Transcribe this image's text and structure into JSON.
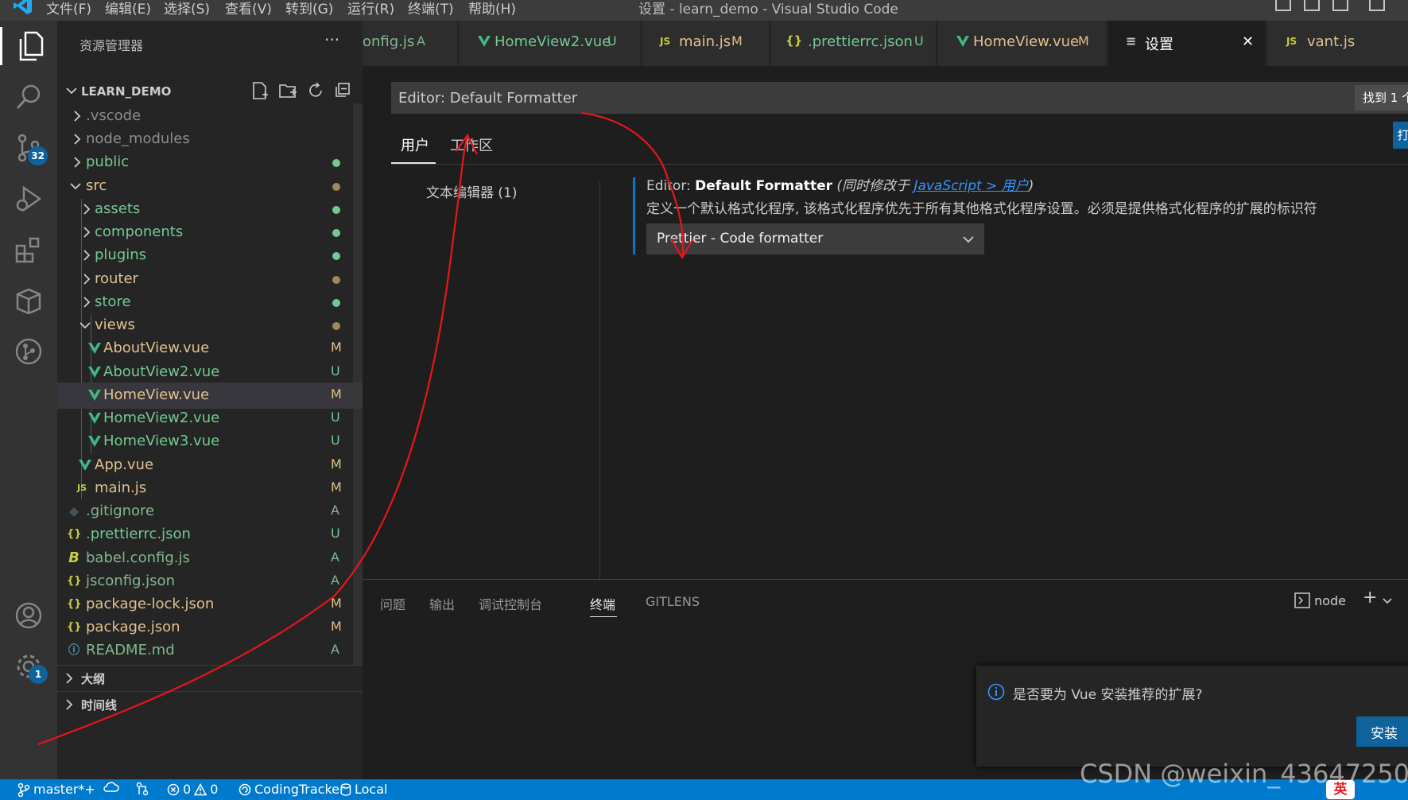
{
  "titlebar": {
    "menus": [
      "文件(F)",
      "编辑(E)",
      "选择(S)",
      "查看(V)",
      "转到(G)",
      "运行(R)",
      "终端(T)",
      "帮助(H)"
    ],
    "window_title": "设置 - learn_demo - Visual Studio Code"
  },
  "activity": {
    "scm_badge": "32",
    "manage_badge": "1"
  },
  "explorer": {
    "header": "资源管理器",
    "more": "···",
    "project": "LEARN_DEMO",
    "items": [
      {
        "label": "vscode",
        "prefix": ".",
        "status": ""
      },
      {
        "label": "node_modules",
        "status": ""
      },
      {
        "label": "public",
        "status": "●"
      },
      {
        "label": "src",
        "status": "●"
      },
      {
        "label": "assets",
        "status": "●"
      },
      {
        "label": "components",
        "status": "●"
      },
      {
        "label": "plugins",
        "status": "●"
      },
      {
        "label": "router",
        "status": "●"
      },
      {
        "label": "store",
        "status": "●"
      },
      {
        "label": "views",
        "status": "●"
      },
      {
        "label": "AboutView.vue",
        "status": "M"
      },
      {
        "label": "AboutView2.vue",
        "status": "U"
      },
      {
        "label": "HomeView.vue",
        "status": "M"
      },
      {
        "label": "HomeView2.vue",
        "status": "U"
      },
      {
        "label": "HomeView3.vue",
        "status": "U"
      },
      {
        "label": "App.vue",
        "status": "M"
      },
      {
        "label": "main.js",
        "status": "M"
      },
      {
        "label": ".gitignore",
        "status": "A"
      },
      {
        "label": ".prettierrc.json",
        "status": "U"
      },
      {
        "label": "babel.config.js",
        "status": "A"
      },
      {
        "label": "jsconfig.json",
        "status": "A"
      },
      {
        "label": "package-lock.json",
        "status": "M"
      },
      {
        "label": "package.json",
        "status": "M"
      },
      {
        "label": "README.md",
        "status": "A"
      }
    ],
    "outline": "大纲",
    "timeline": "时间线"
  },
  "tabs": [
    {
      "icon": "",
      "label": "onfig.js",
      "status": "A"
    },
    {
      "icon": "V",
      "label": "HomeView2.vue",
      "status": "U"
    },
    {
      "icon": "JS",
      "label": "main.js",
      "status": "M"
    },
    {
      "icon": "{}",
      "label": ".prettierrc.json",
      "status": "U"
    },
    {
      "icon": "V",
      "label": "HomeView.vue",
      "status": "M"
    },
    {
      "icon": "≡",
      "label": "设置",
      "status": "✕"
    },
    {
      "icon": "JS",
      "label": "vant.js",
      "status": ""
    }
  ],
  "settings": {
    "search_value": "Editor: Default Formatter",
    "find_count": "找到 1 个",
    "tab_user": "用户",
    "tab_workspace": "工作区",
    "open_json": "打",
    "toc_item": "文本编辑器 (1)",
    "setting_category": "Editor: ",
    "setting_key": "Default Formatter",
    "setting_note_prefix": "(同时修改于 ",
    "setting_note_link": "JavaScript > 用户",
    "setting_note_suffix": ")",
    "setting_desc": "定义一个默认格式化程序, 该格式化程序优先于所有其他格式化程序设置。必须是提供格式化程序的扩展的标识符",
    "formatter_value": "Prettier - Code formatter"
  },
  "panel": {
    "tabs": [
      "问题",
      "输出",
      "调试控制台",
      "终端",
      "GITLENS"
    ],
    "terminal_name": "node"
  },
  "notification": {
    "message": "是否要为 Vue 安装推荐的扩展?",
    "install": "安装"
  },
  "statusbar": {
    "branch": "master*+",
    "errors": "0",
    "warnings": "0",
    "coding_tracker": "CodingTracker",
    "local": "Local",
    "ime": "英"
  },
  "watermark": "CSDN @weixin_43647250",
  "colors": {
    "modified": "#e2c08d",
    "untracked": "#73c991",
    "added": "#81b88b",
    "vue": "#41b883",
    "js": "#cbcb41",
    "accent": "#007acc",
    "annotation": "#e8151b"
  }
}
